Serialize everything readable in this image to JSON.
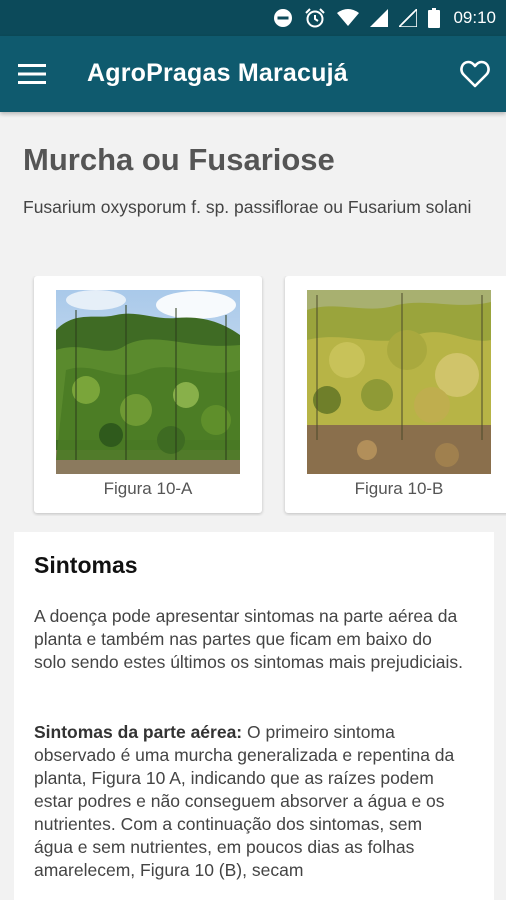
{
  "status_bar": {
    "time": "09:10",
    "icons": [
      "do-not-disturb-icon",
      "alarm-icon",
      "wifi-icon",
      "signal-icon",
      "signal-empty-icon",
      "battery-icon"
    ]
  },
  "app_bar": {
    "title": "AgroPragas Maracujá",
    "menu_icon": "hamburger-menu-icon",
    "favorite_icon": "heart-outline-icon",
    "color": "#0f5a6e"
  },
  "page": {
    "title": "Murcha ou Fusariose",
    "scientific_name": "Fusarium oxysporum f. sp. passiflorae ou Fusarium solani"
  },
  "gallery": [
    {
      "caption": "Figura 10-A"
    },
    {
      "caption": "Figura 10-B"
    }
  ],
  "symptoms": {
    "heading": "Sintomas",
    "intro": "A doença pode apresentar sintomas na parte aérea da planta e também nas partes que ficam em baixo do solo sendo estes últimos os sintomas mais prejudiciais.",
    "aerial_label": "Sintomas da parte aérea:",
    "aerial_text": " O primeiro sintoma observado é uma murcha generalizada e repentina da planta, Figura 10 A, indicando que as raízes podem estar podres e não conseguem absorver a água e os nutrientes. Com a continuação dos sintomas, sem água e sem nutrientes, em poucos dias as folhas amarelecem, Figura 10 (B), secam"
  }
}
